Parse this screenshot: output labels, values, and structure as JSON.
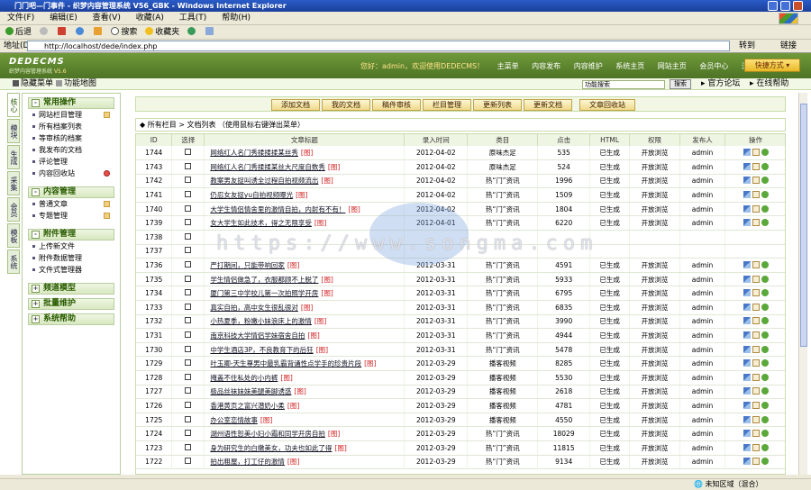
{
  "window": {
    "title": "门门吧—门事件 - 织梦内容管理系统 V56_GBK - Windows Internet Explorer"
  },
  "ie_menu": [
    "文件(F)",
    "编辑(E)",
    "查看(V)",
    "收藏(A)",
    "工具(T)",
    "帮助(H)"
  ],
  "ie_toolbar": {
    "back": "后退",
    "search": "搜索",
    "favorites": "收藏夹"
  },
  "address": {
    "label": "地址(D)",
    "url": "http://localhost/dede/index.php",
    "go": "转到",
    "links": "链接"
  },
  "header": {
    "logo_main": "DEDECMS",
    "logo_sub": "织梦内容管理系统",
    "logo_version": "V5.6",
    "welcome": "您好：admin，欢迎使用DEDECMS！",
    "nav": [
      "主菜单",
      "内容发布",
      "内容维护",
      "系统主页",
      "网站主页",
      "会员中心",
      "注销"
    ],
    "quick": "快捷方式"
  },
  "subbar": {
    "hide_menu": "隐藏菜单",
    "func_map": "功能地图",
    "search_placeholder": "功能搜索",
    "search_btn": "搜索",
    "forum": "官方论坛",
    "help": "在线帮助"
  },
  "vtabs": [
    "核心",
    "模块",
    "生成",
    "采集",
    "会员",
    "模板",
    "系统"
  ],
  "sidebar": {
    "groups": [
      {
        "title": "常用操作",
        "items": [
          "网站栏目管理",
          "所有档案列表",
          "等审核的档案",
          "我发布的文档",
          "评论管理",
          "内容回收站"
        ]
      },
      {
        "title": "内容管理",
        "items": [
          "普通文章",
          "专题管理"
        ]
      },
      {
        "title": "附件管理",
        "items": [
          "上传新文件",
          "附件数据管理",
          "文件式管理器"
        ]
      },
      {
        "title": "频道模型",
        "items": []
      },
      {
        "title": "批量维护",
        "items": []
      },
      {
        "title": "系统帮助",
        "items": []
      }
    ]
  },
  "toolbar": [
    "添加文档",
    "我的文档",
    "稿件审核",
    "栏目管理",
    "更新列表",
    "更新文档",
    "文章回收站"
  ],
  "list_header": "◆ 所有栏目 > 文档列表 （使用鼠标右键弹出菜单）",
  "table": {
    "columns": [
      "ID",
      "选择",
      "文章标题",
      "录入时间",
      "类目",
      "点击",
      "HTML",
      "权限",
      "发布人",
      "操作"
    ],
    "img_tag": "[图]",
    "rows": [
      {
        "id": "1744",
        "title": "网络红人名门秀揉揉揉某丝秀",
        "date": "2012-04-02",
        "cat": "原味杰足",
        "clicks": "535",
        "html": "已生成",
        "perm": "开放浏览",
        "user": "admin"
      },
      {
        "id": "1743",
        "title": "网络红人名门秀揉揉某丝大尺度自数秀",
        "date": "2012-04-02",
        "cat": "原味杰足",
        "clicks": "524",
        "html": "已生成",
        "perm": "开放浏览",
        "user": "admin"
      },
      {
        "id": "1742",
        "title": "教案男友捉叫诱全过程自拍视频流出",
        "date": "2012-04-02",
        "cat": "热“门”资讯",
        "clicks": "1996",
        "html": "已生成",
        "perm": "开放浏览",
        "user": "admin"
      },
      {
        "id": "1741",
        "title": "仍忍女友捉yu自拍视频曝光",
        "date": "2012-04-02",
        "cat": "热“门”资讯",
        "clicks": "1509",
        "html": "已生成",
        "perm": "开放浏览",
        "user": "admin"
      },
      {
        "id": "1740",
        "title": "大学生情侣情舍里的激情自拍，内射有不有！",
        "date": "2012-04-02",
        "cat": "热“门”资讯",
        "clicks": "1804",
        "html": "已生成",
        "perm": "开放浏览",
        "user": "admin"
      },
      {
        "id": "1739",
        "title": "女大学生如此技术，得之无限享受",
        "date": "2012-04-01",
        "cat": "热“门”资讯",
        "clicks": "6220",
        "html": "已生成",
        "perm": "开放浏览",
        "user": "admin"
      },
      {
        "id": "1738",
        "title": "",
        "date": "",
        "cat": "",
        "clicks": "",
        "html": "",
        "perm": "",
        "user": ""
      },
      {
        "id": "1737",
        "title": "",
        "date": "",
        "cat": "",
        "clicks": "",
        "html": "",
        "perm": "",
        "user": ""
      },
      {
        "id": "1736",
        "title": "严打期间，只能带响回家",
        "date": "2012-03-31",
        "cat": "热“门”资讯",
        "clicks": "4591",
        "html": "已生成",
        "perm": "开放浏览",
        "user": "admin"
      },
      {
        "id": "1735",
        "title": "学生情侣做急了，衣服都顾不上脱了",
        "date": "2012-03-31",
        "cat": "热“门”资讯",
        "clicks": "5933",
        "html": "已生成",
        "perm": "开放浏览",
        "user": "admin"
      },
      {
        "id": "1734",
        "title": "厦门第三中学校儿第一次拍照学开房",
        "date": "2012-03-31",
        "cat": "热“门”资讯",
        "clicks": "6795",
        "html": "已生成",
        "perm": "开放浏览",
        "user": "admin"
      },
      {
        "id": "1733",
        "title": "真实自拍，高中女生很乱很对",
        "date": "2012-03-31",
        "cat": "热“门”资讯",
        "clicks": "6835",
        "html": "已生成",
        "perm": "开放浏览",
        "user": "admin"
      },
      {
        "id": "1732",
        "title": "小热夏季，粉嫩小妹浪床上的激情",
        "date": "2012-03-31",
        "cat": "热“门”资讯",
        "clicks": "3990",
        "html": "已生成",
        "perm": "开放浏览",
        "user": "admin"
      },
      {
        "id": "1731",
        "title": "南京科技大学情侣学妹宿舍自拍",
        "date": "2012-03-31",
        "cat": "热“门”资讯",
        "clicks": "4944",
        "html": "已生成",
        "perm": "开放浏览",
        "user": "admin"
      },
      {
        "id": "1730",
        "title": "中学生酒店3P，不良教育下的后狂",
        "date": "2012-03-31",
        "cat": "热“门”资讯",
        "clicks": "5478",
        "html": "已生成",
        "perm": "开放浏览",
        "user": "admin"
      },
      {
        "id": "1729",
        "title": "叶玉卿-天生尊男中最乳霸背诵性点学手的珍贵片段",
        "date": "2012-03-29",
        "cat": "播客视频",
        "clicks": "8285",
        "html": "已生成",
        "perm": "开放浏览",
        "user": "admin"
      },
      {
        "id": "1728",
        "title": "掩盖不住私处的小内裤",
        "date": "2012-03-29",
        "cat": "播客视频",
        "clicks": "5530",
        "html": "已生成",
        "perm": "开放浏览",
        "user": "admin"
      },
      {
        "id": "1727",
        "title": "极品丝袜妹妹美腿美脚诱惑",
        "date": "2012-03-29",
        "cat": "播客视频",
        "clicks": "2618",
        "html": "已生成",
        "perm": "开放浏览",
        "user": "admin"
      },
      {
        "id": "1726",
        "title": "香港黄页之富兴潜奶小柔",
        "date": "2012-03-29",
        "cat": "播客视频",
        "clicks": "4781",
        "html": "已生成",
        "perm": "开放浏览",
        "user": "admin"
      },
      {
        "id": "1725",
        "title": "办公室恋情故事",
        "date": "2012-03-29",
        "cat": "播客视频",
        "clicks": "4550",
        "html": "已生成",
        "perm": "开放浏览",
        "user": "admin"
      },
      {
        "id": "1724",
        "title": "湖州语性恕美小妇小霜和同学开房自拍",
        "date": "2012-03-29",
        "cat": "热“门”资讯",
        "clicks": "18029",
        "html": "已生成",
        "perm": "开放浏览",
        "user": "admin"
      },
      {
        "id": "1723",
        "title": "身为研究生的白嫩美女，功夫也如此了得",
        "date": "2012-03-29",
        "cat": "热“门”资讯",
        "clicks": "11815",
        "html": "已生成",
        "perm": "开放浏览",
        "user": "admin"
      },
      {
        "id": "1722",
        "title": "拍出粗屋，打工仔的激情",
        "date": "2012-03-29",
        "cat": "热“门”资讯",
        "clicks": "9134",
        "html": "已生成",
        "perm": "开放浏览",
        "user": "admin"
      }
    ]
  },
  "watermark": "https://www.songma.com",
  "status": {
    "zone": "未知区域（混合）"
  }
}
